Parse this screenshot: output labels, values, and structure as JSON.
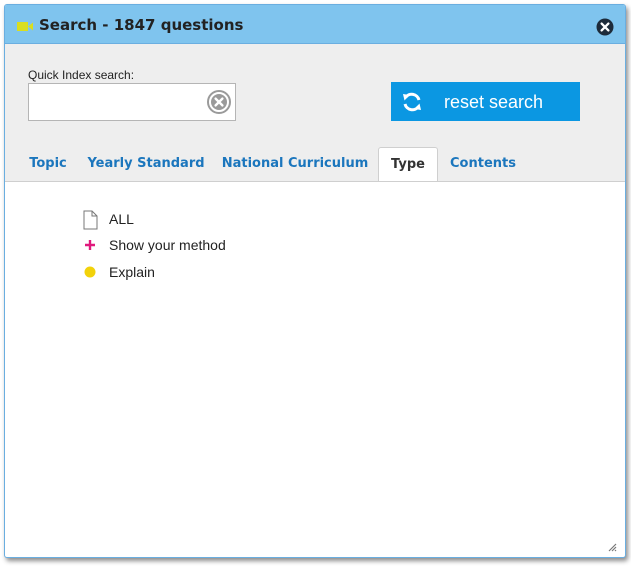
{
  "dialog": {
    "title": "Search - 1847 questions",
    "title_icon": "video-camera-icon",
    "close_icon": "close-circle-icon"
  },
  "search": {
    "label": "Quick Index search:",
    "value": "",
    "placeholder": "",
    "clear_icon": "clear-circle-icon",
    "reset_label": "reset search",
    "reset_icon": "refresh-icon"
  },
  "tabs": [
    {
      "label": "Topic",
      "active": false
    },
    {
      "label": "Yearly Standard",
      "active": false
    },
    {
      "label": "National Curriculum",
      "active": false
    },
    {
      "label": "Type",
      "active": true
    },
    {
      "label": "Contents",
      "active": false
    }
  ],
  "type_list": [
    {
      "label": "ALL",
      "icon": "document-icon"
    },
    {
      "label": "Show your method",
      "icon": "plus-icon"
    },
    {
      "label": "Explain",
      "icon": "dot-icon"
    }
  ],
  "colors": {
    "titlebar": "#7fc4ee",
    "accent_button": "#0b97e2",
    "tab_text": "#1b76bd",
    "title_icon": "#d9de1f",
    "plus_icon": "#e0197d",
    "dot_icon": "#f2d20a"
  }
}
